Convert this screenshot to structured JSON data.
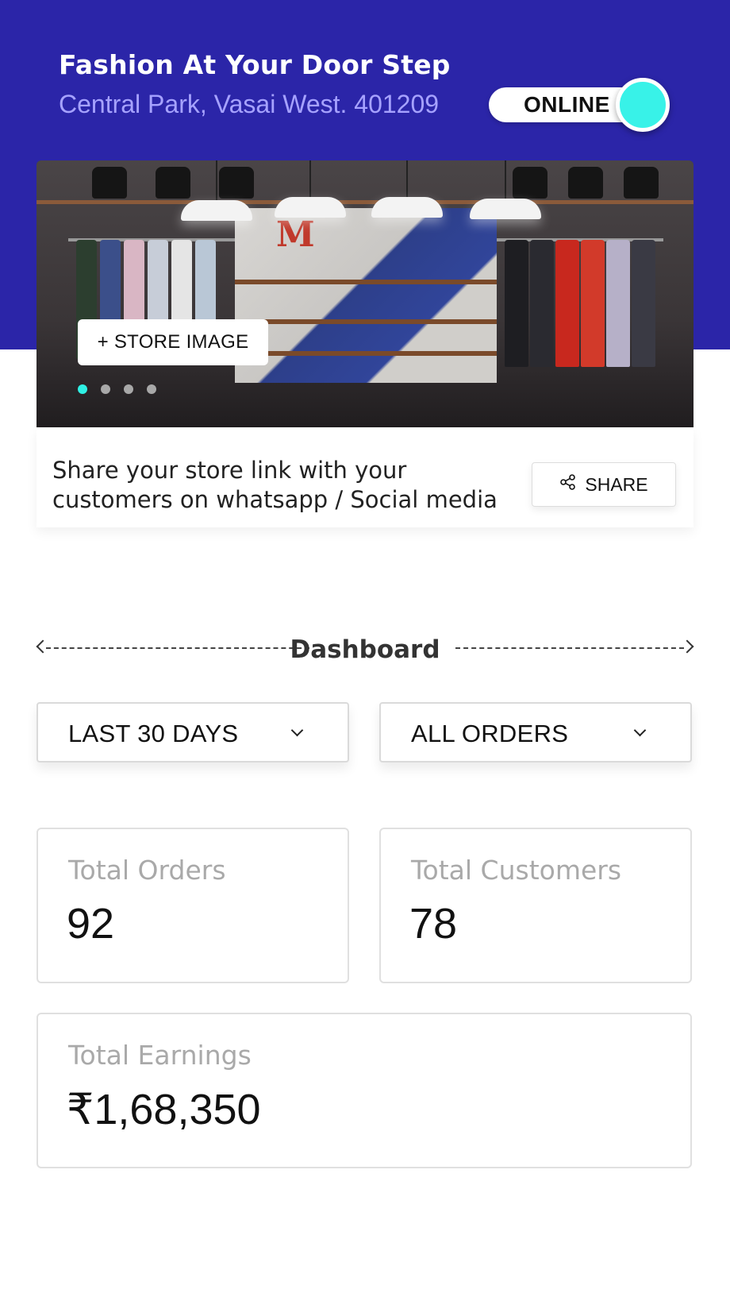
{
  "header": {
    "store_name": "Fashion At Your Door Step",
    "store_address": "Central Park, Vasai West. 401209",
    "status_toggle": {
      "label": "ONLINE",
      "state": "on",
      "knob_color": "#38f2e8"
    },
    "background_color": "#2b25a8"
  },
  "store_image": {
    "add_button_label": "+ STORE IMAGE",
    "carousel": {
      "count": 4,
      "active_index": 0
    }
  },
  "share": {
    "text_line1": "Share your store link with your",
    "text_line2": "customers on whatsapp / Social media",
    "button_label": "SHARE",
    "button_icon": "share-icon"
  },
  "dashboard": {
    "title": "Dashboard",
    "filters": {
      "period": "LAST 30 DAYS",
      "orders": "ALL ORDERS"
    },
    "stats": {
      "total_orders_label": "Total Orders",
      "total_orders_value": "92",
      "total_customers_label": "Total Customers",
      "total_customers_value": "78",
      "total_earnings_label": "Total Earnings",
      "total_earnings_value": "₹1,68,350"
    }
  }
}
